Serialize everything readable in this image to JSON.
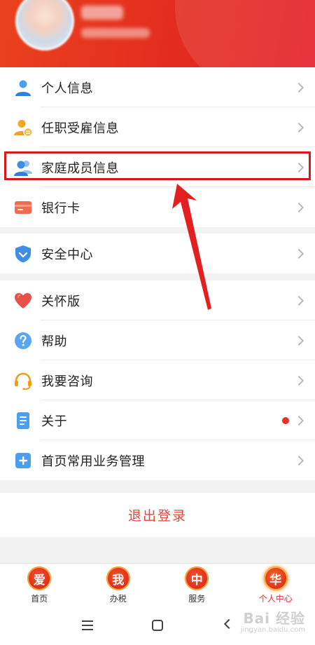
{
  "menu_group_1": [
    {
      "label": "个人信息",
      "icon": "person-icon"
    },
    {
      "label": "任职受雇信息",
      "icon": "employment-icon"
    },
    {
      "label": "家庭成员信息",
      "icon": "family-icon"
    },
    {
      "label": "银行卡",
      "icon": "bank-card-icon"
    }
  ],
  "menu_group_2": [
    {
      "label": "安全中心",
      "icon": "shield-icon"
    }
  ],
  "menu_group_3": [
    {
      "label": "关怀版",
      "icon": "heart-icon"
    },
    {
      "label": "帮助",
      "icon": "help-icon"
    },
    {
      "label": "我要咨询",
      "icon": "headset-icon"
    },
    {
      "label": "关于",
      "icon": "document-icon"
    },
    {
      "label": "首页常用业务管理",
      "icon": "plus-icon"
    }
  ],
  "logout_label": "退出登录",
  "tabs": [
    {
      "glyph": "爱",
      "label": "首页"
    },
    {
      "glyph": "我",
      "label": "办税"
    },
    {
      "glyph": "中",
      "label": "服务"
    },
    {
      "glyph": "华",
      "label": "个人中心"
    }
  ],
  "watermark": {
    "brand": "Bai 经验",
    "url": "jingyan.baidu.com"
  },
  "colors": {
    "accent": "#e8302a",
    "highlight": "#d8191c",
    "icon_blue": "#3d8fe6"
  }
}
